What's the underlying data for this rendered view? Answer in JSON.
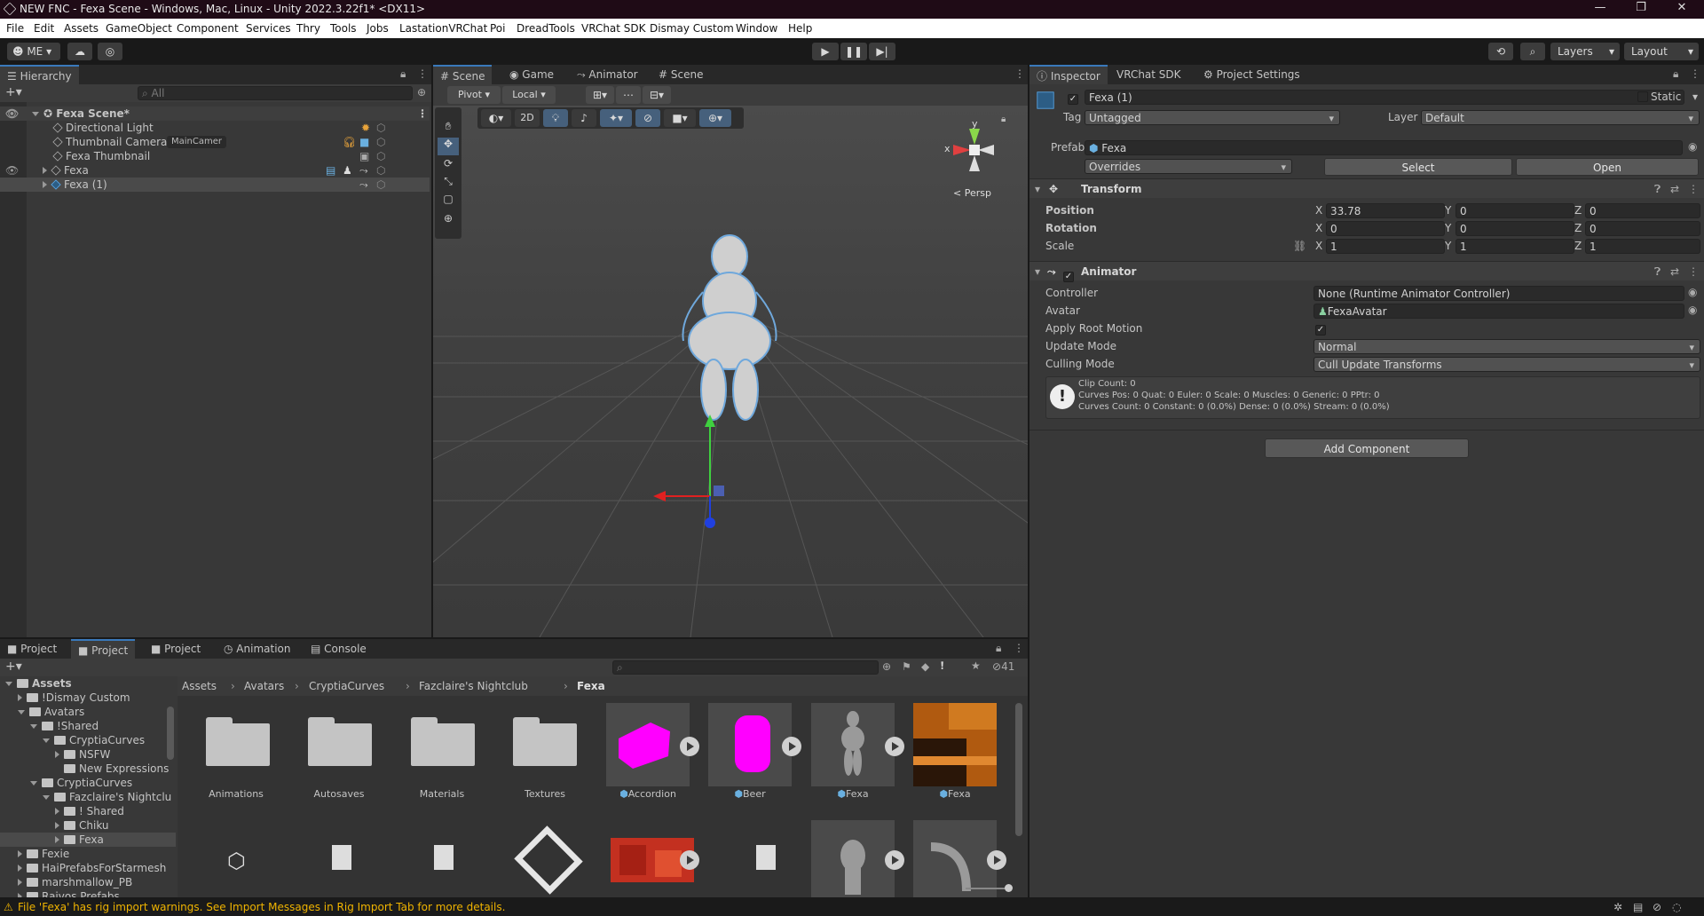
{
  "window": {
    "title": "NEW FNC - Fexa Scene - Windows, Mac, Linux - Unity 2022.3.22f1* <DX11>"
  },
  "menu": [
    "File",
    "Edit",
    "Assets",
    "GameObject",
    "Component",
    "Services",
    "Thry",
    "Tools",
    "Jobs",
    "LastationVRChat",
    "Poi",
    "DreadTools",
    "VRChat SDK",
    "Dismay Custom",
    "Window",
    "Help"
  ],
  "toolbar": {
    "account": "ME",
    "layers": "Layers",
    "layout": "Layout"
  },
  "hierarchy": {
    "tab": "Hierarchy",
    "search_placeholder": "All",
    "scene": "Fexa Scene*",
    "items": [
      {
        "label": "Directional Light"
      },
      {
        "label": "Thumbnail Camera",
        "tag": "MainCamer"
      },
      {
        "label": "Fexa Thumbnail"
      },
      {
        "label": "Fexa"
      },
      {
        "label": "Fexa (1)"
      }
    ]
  },
  "scene_tabs": [
    "Scene",
    "Game",
    "Animator",
    "Scene"
  ],
  "scene_toolbar": {
    "pivot": "Pivot",
    "local": "Local",
    "mode2d": "2D",
    "persp": "< Persp",
    "gizmo_y": "y",
    "gizmo_x": "x"
  },
  "inspector": {
    "tabs": [
      "Inspector",
      "VRChat SDK",
      "Project Settings"
    ],
    "object_name": "Fexa (1)",
    "static_label": "Static",
    "tag_label": "Tag",
    "tag_value": "Untagged",
    "layer_label": "Layer",
    "layer_value": "Default",
    "prefab_label": "Prefab",
    "prefab_value": "Fexa",
    "overrides": "Overrides",
    "select": "Select",
    "open": "Open",
    "transform": {
      "title": "Transform",
      "position_label": "Position",
      "rotation_label": "Rotation",
      "scale_label": "Scale",
      "axes": [
        "X",
        "Y",
        "Z"
      ],
      "position": [
        "33.78",
        "0",
        "0"
      ],
      "rotation": [
        "0",
        "0",
        "0"
      ],
      "scale": [
        "1",
        "1",
        "1"
      ]
    },
    "animator": {
      "title": "Animator",
      "controller_label": "Controller",
      "controller_value": "None (Runtime Animator Controller)",
      "avatar_label": "Avatar",
      "avatar_value": "FexaAvatar",
      "apply_root_label": "Apply Root Motion",
      "update_mode_label": "Update Mode",
      "update_mode_value": "Normal",
      "culling_label": "Culling Mode",
      "culling_value": "Cull Update Transforms",
      "info_line1": "Clip Count: 0",
      "info_line2": "Curves Pos: 0 Quat: 0 Euler: 0 Scale: 0 Muscles: 0 Generic: 0 PPtr: 0",
      "info_line3": "Curves Count: 0 Constant: 0 (0.0%) Dense: 0 (0.0%) Stream: 0 (0.0%)"
    },
    "add_component": "Add Component"
  },
  "bottom_tabs": [
    "Project",
    "Project",
    "Project",
    "Animation",
    "Console"
  ],
  "project": {
    "hidden_count": "41",
    "breadcrumb": [
      "Assets",
      "Avatars",
      "CryptiaCurves",
      "Fazclaire's Nightclub",
      "Fexa"
    ],
    "tree": [
      {
        "label": "Assets",
        "depth": 0,
        "bold": true
      },
      {
        "label": "!Dismay Custom",
        "depth": 1
      },
      {
        "label": "Avatars",
        "depth": 1
      },
      {
        "label": "!Shared",
        "depth": 2
      },
      {
        "label": "CryptiaCurves",
        "depth": 3
      },
      {
        "label": "NSFW",
        "depth": 4
      },
      {
        "label": "New Expressions",
        "depth": 4
      },
      {
        "label": "CryptiaCurves",
        "depth": 2
      },
      {
        "label": "Fazclaire's Nightclu",
        "depth": 3
      },
      {
        "label": "! Shared",
        "depth": 4
      },
      {
        "label": "Chiku",
        "depth": 4
      },
      {
        "label": "Fexa",
        "depth": 4
      },
      {
        "label": "Fexie",
        "depth": 1
      },
      {
        "label": "HaiPrefabsForStarmesh",
        "depth": 1
      },
      {
        "label": "marshmallow_PB",
        "depth": 1
      },
      {
        "label": "Raivos Prefabs",
        "depth": 1
      }
    ],
    "assets": [
      {
        "label": "Animations"
      },
      {
        "label": "Autosaves"
      },
      {
        "label": "Materials"
      },
      {
        "label": "Textures"
      },
      {
        "label": "Accordion"
      },
      {
        "label": "Beer"
      },
      {
        "label": "Fexa"
      },
      {
        "label": "Fexa"
      }
    ]
  },
  "status": {
    "message": "File 'Fexa' has rig import warnings. See Import Messages in Rig Import Tab for more details."
  },
  "colors": {
    "accent": "#3a79bb",
    "magenta": "#ff00ff",
    "warning": "#f0b400"
  }
}
